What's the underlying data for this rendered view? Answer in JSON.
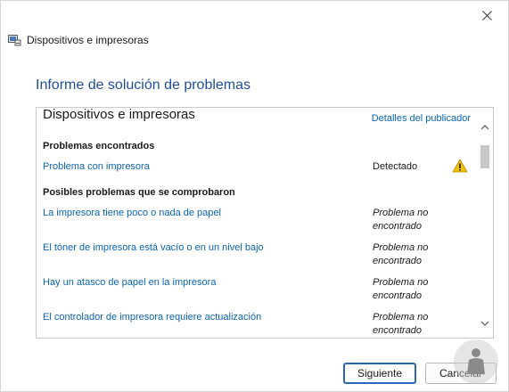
{
  "window": {
    "title": "Dispositivos e impresoras",
    "app_icon": "devices-printers-icon",
    "close_icon": "close-icon"
  },
  "heading": "Informe de solución de problemas",
  "report": {
    "header": "Dispositivos e impresoras",
    "publisher_link": "Detalles del publicador",
    "found_section": "Problemas encontrados",
    "found_items": [
      {
        "label": "Problema con impresora",
        "status": "Detectado",
        "icon": "warning-icon"
      }
    ],
    "checked_section": "Posibles problemas que se comprobaron",
    "checked_items": [
      {
        "label": "La impresora tiene poco o nada de papel",
        "status_line1": "Problema no",
        "status_line2": "encontrado"
      },
      {
        "label": "El tóner de impresora está vacío o en un nivel bajo",
        "status_line1": "Problema no",
        "status_line2": "encontrado"
      },
      {
        "label": "Hay un atasco de papel en la impresora",
        "status_line1": "Problema no",
        "status_line2": "encontrado"
      },
      {
        "label": "El controlador de impresora requiere actualización",
        "status_line1": "Problema no",
        "status_line2": "encontrado"
      }
    ]
  },
  "buttons": {
    "next": "Siguiente",
    "cancel": "Cancelar"
  },
  "colors": {
    "link": "#0a64b4",
    "heading": "#1f4e96",
    "warning": "#f2c200",
    "primary_border": "#2a66b8"
  }
}
